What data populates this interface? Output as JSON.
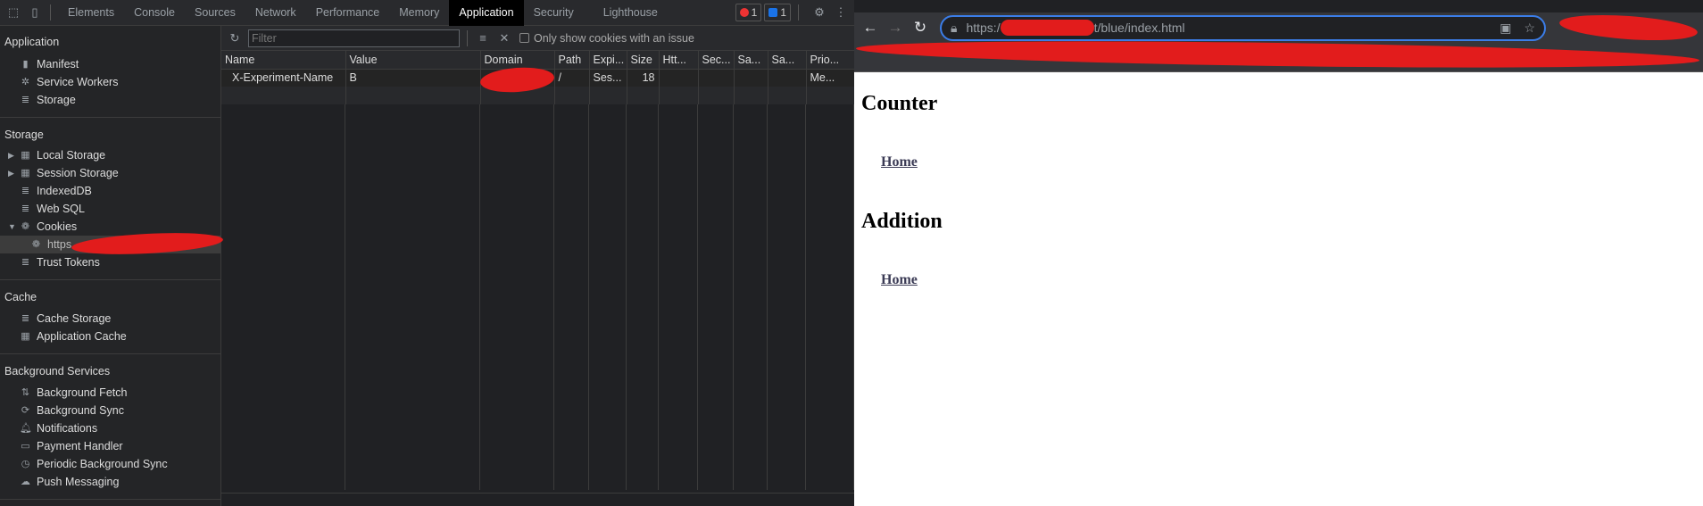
{
  "devtools": {
    "tabs": [
      "Elements",
      "Console",
      "Sources",
      "Network",
      "Performance",
      "Memory",
      "Application",
      "Security",
      "Lighthouse"
    ],
    "active_tab": "Application",
    "error_count": "1",
    "message_count": "1",
    "sidebar": {
      "sections": [
        {
          "title": "Application",
          "items": [
            {
              "label": "Manifest",
              "icon": "file-icon"
            },
            {
              "label": "Service Workers",
              "icon": "gear-icon"
            },
            {
              "label": "Storage",
              "icon": "database-icon"
            }
          ]
        },
        {
          "title": "Storage",
          "items": [
            {
              "label": "Local Storage",
              "icon": "grid-icon"
            },
            {
              "label": "Session Storage",
              "icon": "grid-icon"
            },
            {
              "label": "IndexedDB",
              "icon": "database-icon"
            },
            {
              "label": "Web SQL",
              "icon": "database-icon"
            },
            {
              "label": "Cookies",
              "icon": "cookie-icon"
            },
            {
              "label": "https",
              "icon": "cookie-icon"
            },
            {
              "label": "Trust Tokens",
              "icon": "database-icon"
            }
          ]
        },
        {
          "title": "Cache",
          "items": [
            {
              "label": "Cache Storage",
              "icon": "database-icon"
            },
            {
              "label": "Application Cache",
              "icon": "grid-icon"
            }
          ]
        },
        {
          "title": "Background Services",
          "items": [
            {
              "label": "Background Fetch",
              "icon": "arrows-icon"
            },
            {
              "label": "Background Sync",
              "icon": "sync-icon"
            },
            {
              "label": "Notifications",
              "icon": "bell-icon"
            },
            {
              "label": "Payment Handler",
              "icon": "card-icon"
            },
            {
              "label": "Periodic Background Sync",
              "icon": "clock-icon"
            },
            {
              "label": "Push Messaging",
              "icon": "cloud-icon"
            }
          ]
        }
      ]
    },
    "toolbar": {
      "filter_placeholder": "Filter",
      "only_issues_label": "Only show cookies with an issue"
    },
    "table": {
      "columns": [
        "Name",
        "Value",
        "Domain",
        "Path",
        "Expi...",
        "Size",
        "Htt...",
        "Sec...",
        "Sa...",
        "Sa...",
        "Prio..."
      ],
      "rows": [
        [
          "X-Experiment-Name",
          "B",
          "",
          "/",
          "Ses...",
          "18",
          "",
          "",
          "",
          "",
          "Me..."
        ]
      ]
    }
  },
  "browser": {
    "url_prefix": "https:/",
    "url_suffix": "t/blue/index.html",
    "page": {
      "heading1": "Counter",
      "link1": "Home",
      "heading2": "Addition",
      "link2": "Home"
    }
  }
}
